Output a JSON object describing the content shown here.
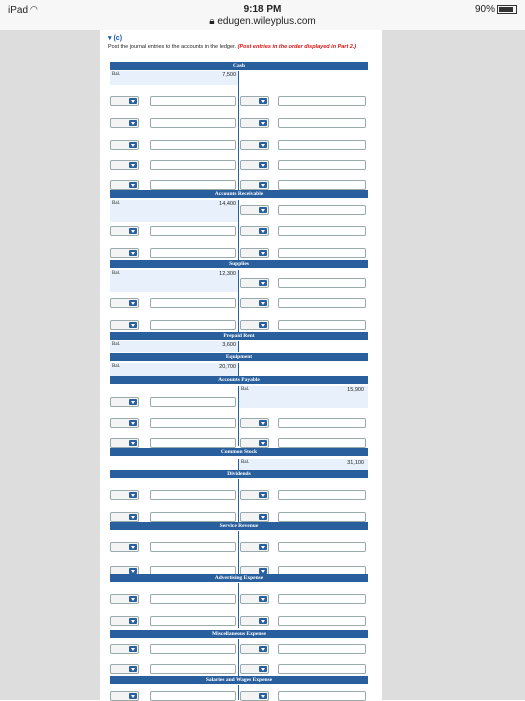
{
  "status_bar": {
    "device": "iPad",
    "time": "9:18 PM",
    "url": "edugen.wileyplus.com",
    "battery": "90%"
  },
  "part": {
    "label": "(c)"
  },
  "instructions": {
    "text": "Post the journal entries to the accounts in the ledger.",
    "note": "(Post entries in the order displayed in Part 2.)"
  },
  "ledger": {
    "balance_label": "Bal.",
    "accounts": {
      "cash": {
        "title": "Cash",
        "balance": "7,500"
      },
      "accounts_receivable": {
        "title": "Accounts Receivable",
        "balance": "14,400"
      },
      "supplies": {
        "title": "Supplies",
        "balance": "12,300"
      },
      "prepaid_rent": {
        "title": "Prepaid Rent",
        "balance": "3,600"
      },
      "equipment": {
        "title": "Equipment",
        "balance": "20,700"
      },
      "accounts_payable": {
        "title": "Accounts Payable",
        "balance": "15,900"
      },
      "common_stock": {
        "title": "Common Stock",
        "balance": "31,100"
      },
      "dividends": {
        "title": "Dividends"
      },
      "service_revenue": {
        "title": "Service Revenue"
      },
      "advertising_expense": {
        "title": "Advertising Expense"
      },
      "miscellaneous_expense": {
        "title": "Miscellaneous Expense"
      },
      "salaries_wages_expense": {
        "title": "Salaries and Wages Expense"
      }
    }
  },
  "icons": {
    "wifi": "wifi-icon",
    "dropdown": "dropdown-arrow-icon",
    "lock": "lock-icon",
    "collapse": "triangle-down-icon"
  }
}
